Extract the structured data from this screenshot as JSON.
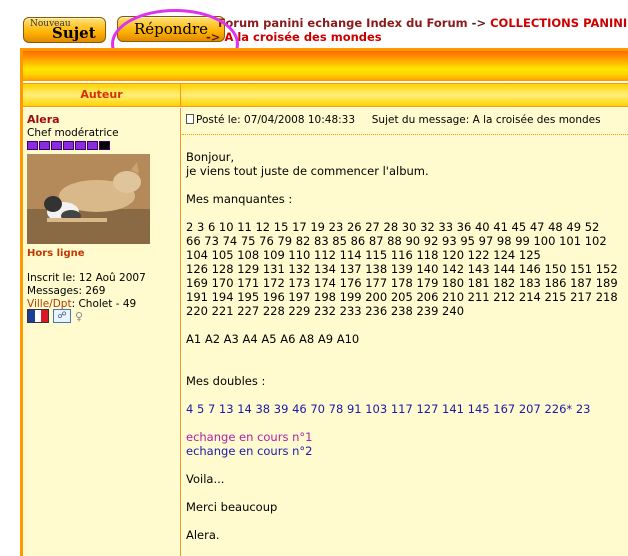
{
  "toolbar": {
    "new_topic_small": "Nouveau",
    "new_topic_big": "Sujet",
    "reply_label": "Répondre"
  },
  "breadcrumb": {
    "forum": "Forum panini echange Index du Forum",
    "sep1": "->",
    "collections": "COLLECTIONS PANINI",
    "sep2": "->",
    "topic": "A la croisée des mondes"
  },
  "table": {
    "author_header": "Auteur"
  },
  "author": {
    "username": "Alera",
    "rank": "Chef modératrice",
    "rank_filled": 6,
    "rank_total": 7,
    "status": "Hors ligne",
    "joined": "Inscrit le: 12 Aoû 2007",
    "messages": "Messages: 269",
    "location_label": "Ville/Dpt",
    "location_value": ": Cholet - 49",
    "gender_icon": "female-symbol"
  },
  "post": {
    "posted": "Posté le: 07/04/2008 10:48:33",
    "subject": "Sujet du message: A la croisée des mondes",
    "greeting": "Bonjour,",
    "intro": "je viens tout juste de commencer l'album.",
    "missing_title": "Mes manquantes :",
    "missing_lines": [
      "2 3 6 10 11 12 15 17 19 23 26 27 28 30 32 33 36 40 41 45 47 48 49 52",
      "66 73 74 75 76 79 82 83 85 86 87 88 90 92 93 95 97 98 99 100 101 102",
      "104 105 108 109 110 112 114 115 116 118 120 122 124 125",
      "126 128 129 131 132 134 137 138 139 140 142 143 144 146 150 151 152",
      "169 170 171 172 173 174 176 177 178 179 180 181 182 183 186 187 189",
      "191 194 195 196 197 198 199 200 205 206 210 211 212 214 215 217 218",
      "220 221 227 228 229 232 233 236 238 239 240"
    ],
    "missing_letters": "A1 A2 A3 A4 A5 A6 A8 A9 A10",
    "doubles_title": "Mes doubles :",
    "doubles_line": "4 5 7 13 14 38 39 46 70 78 91 103 117 127 141 145 167 207 226* 23",
    "exchange_1": "echange en cours n°1",
    "exchange_2": "echange en cours n°2",
    "voila": "Voila...",
    "thanks": "Merci beaucoup",
    "signature": "Alera."
  },
  "colors": {
    "crumb": "#8b1a1a",
    "accent_orange": "#ff9900",
    "panel_bg": "#fffbcf",
    "highlight_circle": "#dd33ee",
    "blue_number": "#1a1aa6",
    "purple_number": "#b01ea6"
  }
}
